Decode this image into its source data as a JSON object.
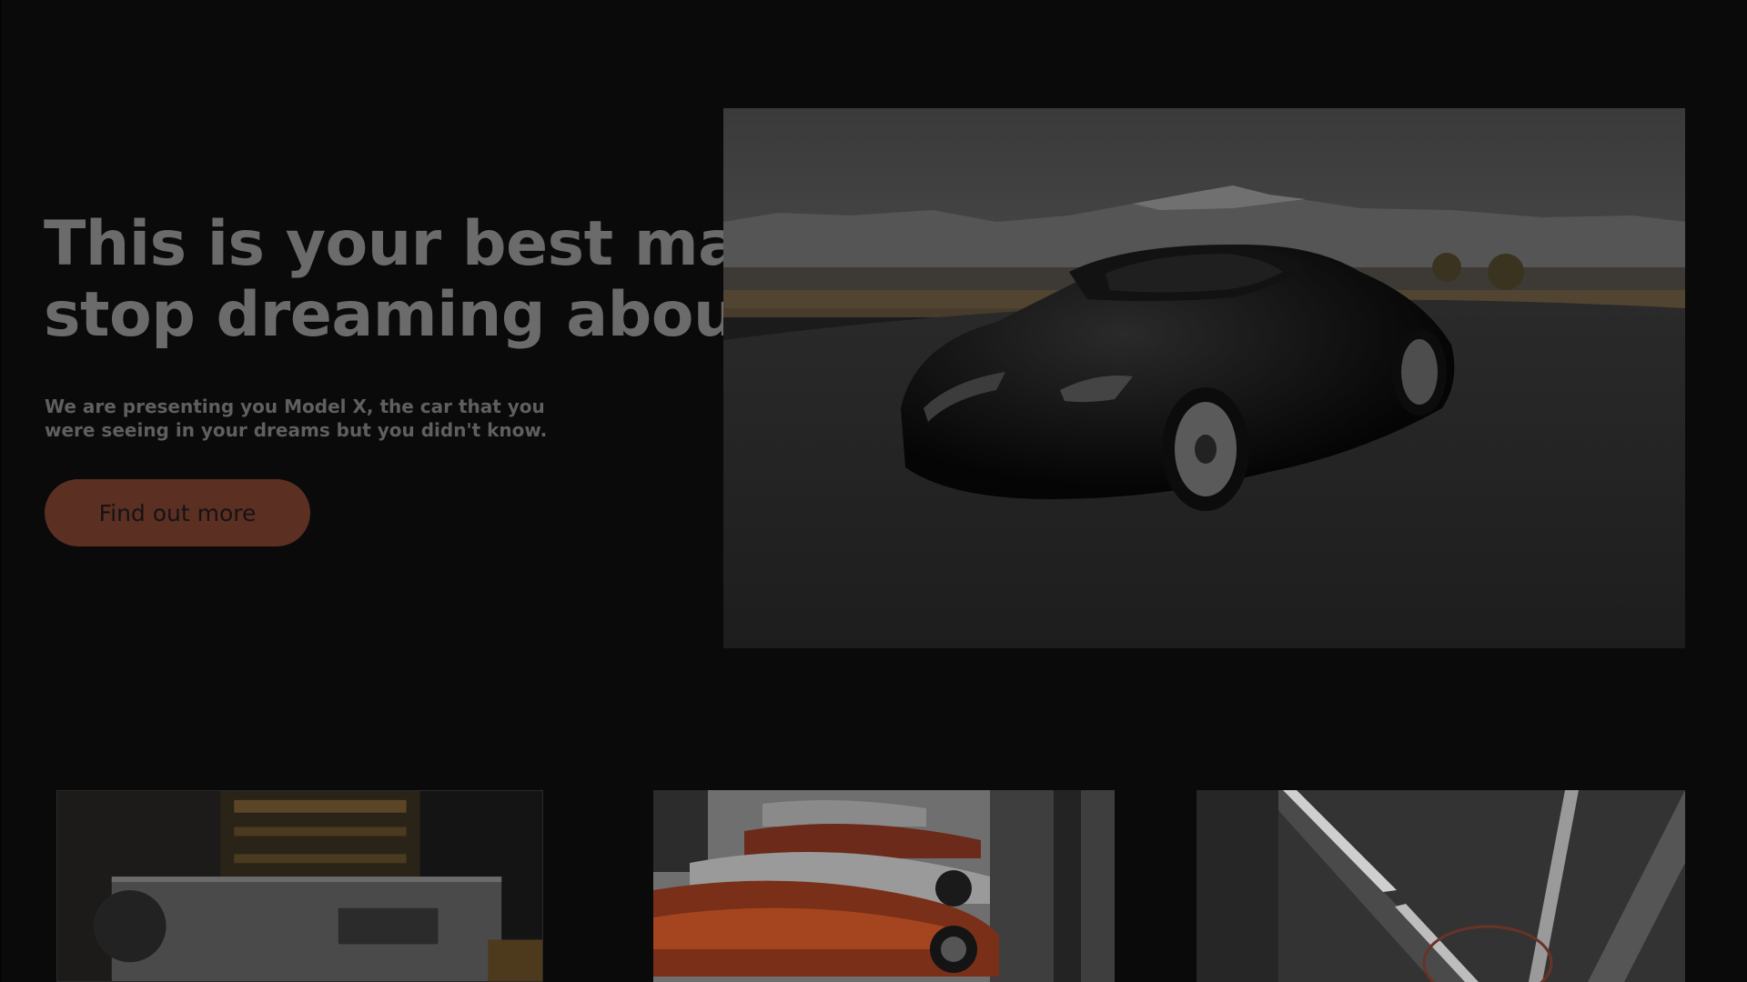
{
  "hero": {
    "headline_line1": "This is your best match,",
    "headline_line2": "stop dreaming about it.",
    "subtext_line1": "We are presenting you Model X, the car that you",
    "subtext_line2": "were seeing in your dreams but you didn't know.",
    "cta_label": "Find out more",
    "image_alt": "Black sports car parked on asphalt with mountains in the background"
  },
  "gallery": {
    "tiles": [
      {
        "alt": "Building facade at night with lit windows and sign"
      },
      {
        "alt": "Row of red and silver sports cars in a showroom"
      },
      {
        "alt": "Tunnel with overhead light strips"
      }
    ]
  },
  "colors": {
    "background": "#0a0a0a",
    "headline": "#6b6b6b",
    "subtext": "#5f5f5f",
    "cta_background": "#5b2f22",
    "cta_text": "#141414"
  }
}
